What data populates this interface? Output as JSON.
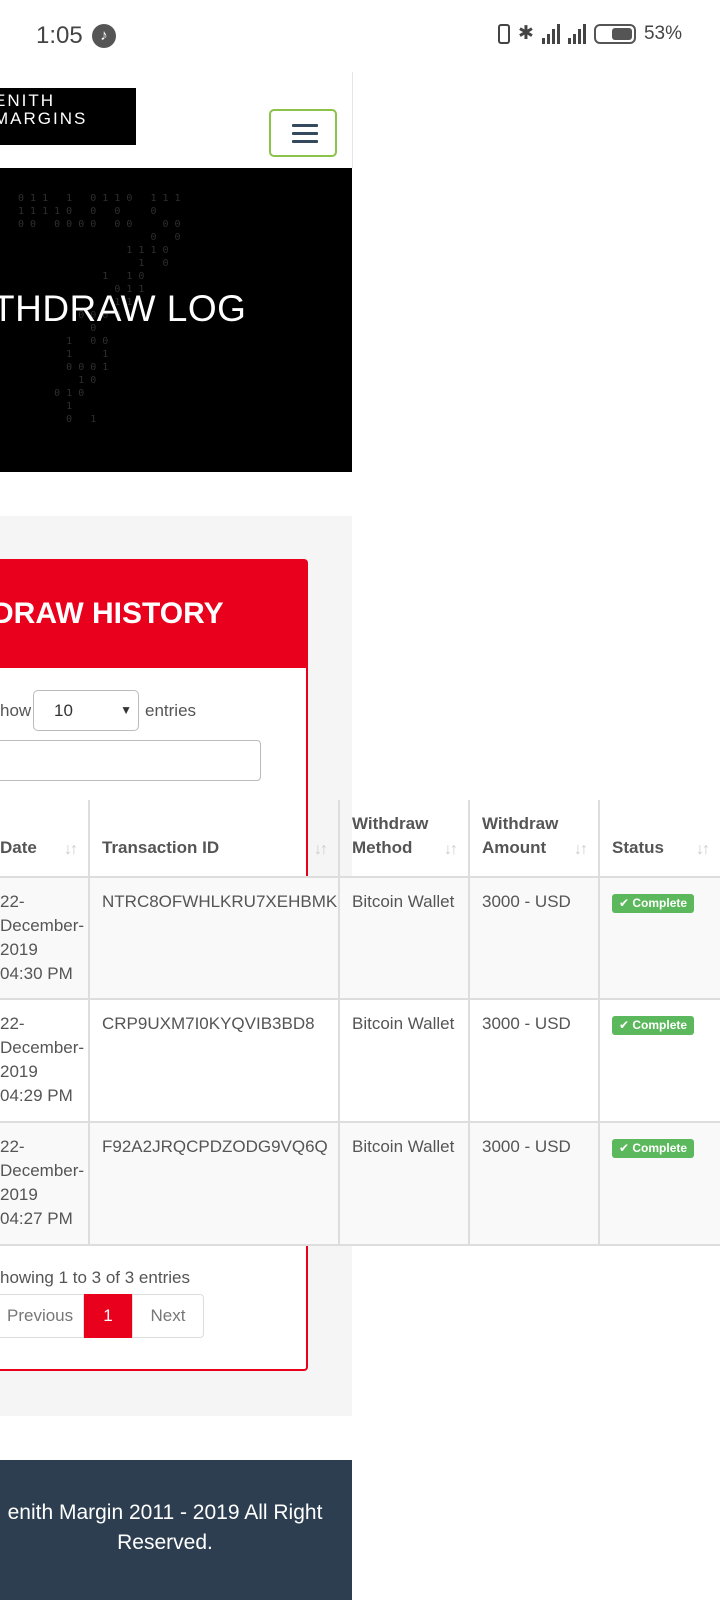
{
  "status_bar": {
    "time": "1:05",
    "music_icon": "music-note-icon",
    "battery": "53%"
  },
  "header": {
    "logo_line1": "ENITH",
    "logo_line2": "MARGINS",
    "menu_icon": "hamburger-icon",
    "menu_button_border": "#8bc34a"
  },
  "hero": {
    "title": "THDRAW LOG"
  },
  "card": {
    "title": "DRAW HISTORY",
    "accent": "#e8001c",
    "show_label": "how",
    "entries_select": "10",
    "entries_label": "entries"
  },
  "table": {
    "headers": {
      "date": "Date",
      "transaction_id": "Transaction ID",
      "method": "Withdraw Method",
      "amount": "Withdraw Amount",
      "status": "Status"
    },
    "rows": [
      {
        "date": "22-December-2019 04:30 PM",
        "transaction_id": "NTRC8OFWHLKRU7XEHBMK",
        "method": "Bitcoin Wallet",
        "amount": "3000 - USD",
        "status": "Complete"
      },
      {
        "date": "22-December-2019 04:29 PM",
        "transaction_id": "CRP9UXM7I0KYQVIB3BD8",
        "method": "Bitcoin Wallet",
        "amount": "3000 - USD",
        "status": "Complete"
      },
      {
        "date": "22-December-2019 04:27 PM",
        "transaction_id": "F92A2JRQCPDZODG9VQ6Q",
        "method": "Bitcoin Wallet",
        "amount": "3000 - USD",
        "status": "Complete"
      }
    ],
    "status_color": "#5cb85c"
  },
  "pagination": {
    "info": "howing 1 to 3 of 3 entries",
    "previous": "Previous",
    "current": "1",
    "next": "Next"
  },
  "footer": {
    "copyright": "enith Margin 2011 - 2019 All Right Reserved.",
    "background": "#2c3e50"
  }
}
